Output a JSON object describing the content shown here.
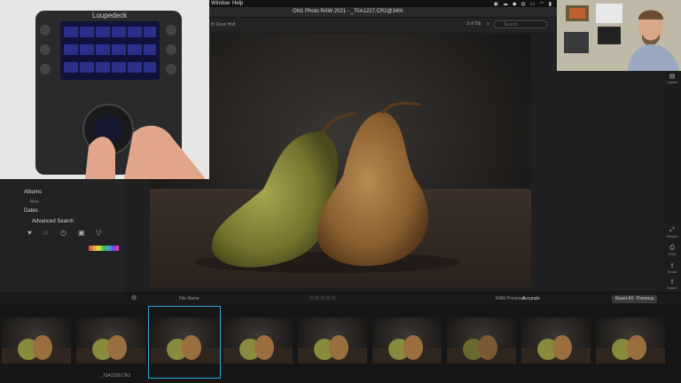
{
  "menu": {
    "window": "Window",
    "help": "Help"
  },
  "window_title": "ON1 Photo RAW 2021 - _70A1227.CR2@34%",
  "toolbar": {
    "breadcrumb": "th Dave Holt",
    "counter": "3 of 59",
    "search_placeholder": "Search"
  },
  "device": {
    "brand": "Loupedeck"
  },
  "left_panel": {
    "albums": "Albums",
    "album_item": "Men",
    "dates": "Dates",
    "advanced_search": "Advanced Search"
  },
  "bottom_bar": {
    "sort_label": "File Name",
    "raw_previews_label": "RAW Previews",
    "raw_previews_value": "Accurate",
    "reset_all": "Reset All",
    "previous": "Previous"
  },
  "right_panel": {
    "items": [
      {
        "icon": "layers-icon",
        "label": "Layers"
      },
      {
        "icon": "resize-icon",
        "label": "Resize"
      },
      {
        "icon": "print-icon",
        "label": "Print"
      },
      {
        "icon": "share-icon",
        "label": "Share"
      },
      {
        "icon": "export-icon",
        "label": "Export"
      }
    ]
  },
  "filmstrip": {
    "selected_index": 2,
    "filename": "_70A1228.CR2"
  },
  "colors": {
    "accent": "#30a8d8",
    "background": "#1c1c1e",
    "pear_green": "#8a8a3c",
    "pear_brown": "#9a6e3e"
  }
}
